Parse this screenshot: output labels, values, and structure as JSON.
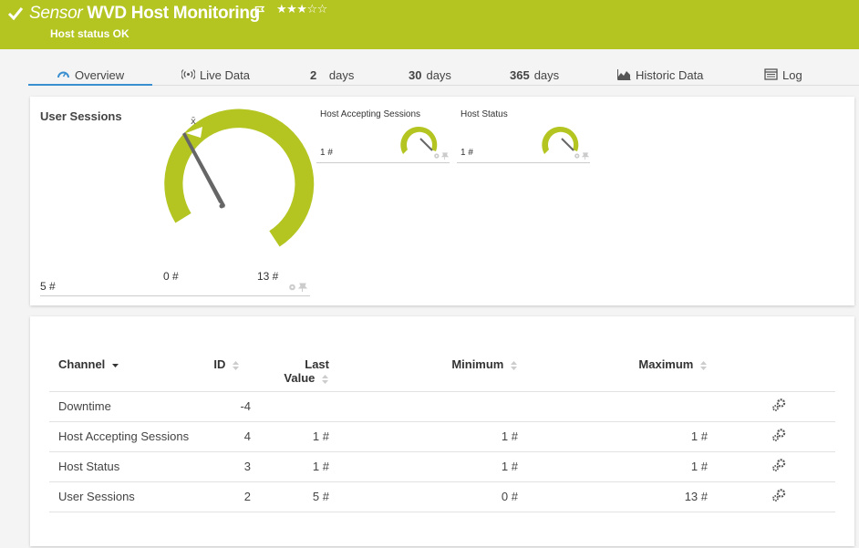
{
  "header": {
    "prefix": "Sensor",
    "title": "WVD Host Monitoring",
    "stars": "★★★☆☆",
    "status": "Host status OK",
    "accent_color": "#b4c522"
  },
  "tabs": [
    {
      "label": "Overview",
      "icon": "gauge-icon",
      "active": true
    },
    {
      "label": "Live Data",
      "icon": "broadcast-icon"
    },
    {
      "num": "2",
      "label": "days"
    },
    {
      "num": "30",
      "label": "days"
    },
    {
      "num": "365",
      "label": "days"
    },
    {
      "label": "Historic Data",
      "icon": "area-chart-icon"
    },
    {
      "label": "Log",
      "icon": "log-icon"
    }
  ],
  "gauges": {
    "main": {
      "title": "User Sessions",
      "value": "5 #",
      "min_label": "0 #",
      "max_label": "13 #",
      "avg_marker": "x̄",
      "min": 0,
      "max": 13,
      "current": 5
    },
    "accepting": {
      "title": "Host Accepting Sessions",
      "value": "1 #",
      "current": 1
    },
    "status": {
      "title": "Host Status",
      "value": "1 #",
      "current": 1
    }
  },
  "table": {
    "headers": {
      "channel": "Channel",
      "id": "ID",
      "last_1": "Last",
      "last_2": "Value",
      "minimum": "Minimum",
      "maximum": "Maximum"
    },
    "rows": [
      {
        "channel": "Downtime",
        "id": "-4",
        "last": "",
        "min": "",
        "max": ""
      },
      {
        "channel": "Host Accepting Sessions",
        "id": "4",
        "last": "1 #",
        "min": "1 #",
        "max": "1 #"
      },
      {
        "channel": "Host Status",
        "id": "3",
        "last": "1 #",
        "min": "1 #",
        "max": "1 #"
      },
      {
        "channel": "User Sessions",
        "id": "2",
        "last": "5 #",
        "min": "0 #",
        "max": "13 #"
      }
    ]
  }
}
